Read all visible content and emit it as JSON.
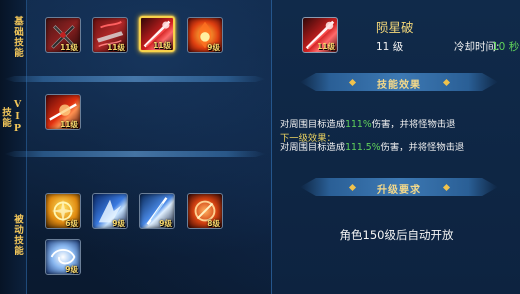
{
  "categories": {
    "base": "基础技能",
    "vip": "VIP技能",
    "passive": "被动技能"
  },
  "base_skills": [
    {
      "icon": "twin-blade-skill-icon",
      "level": "11级"
    },
    {
      "icon": "charging-blade-skill-icon",
      "level": "11级"
    },
    {
      "icon": "meteor-slash-skill-icon",
      "level": "11级",
      "selected": true
    },
    {
      "icon": "flame-burst-skill-icon",
      "level": "9级"
    }
  ],
  "vip_skills": [
    {
      "icon": "fire-strike-skill-icon",
      "level": "11级"
    }
  ],
  "passive_skills": [
    {
      "icon": "golden-aura-skill-icon",
      "level": "6级"
    },
    {
      "icon": "ice-shard-skill-icon",
      "level": "9级"
    },
    {
      "icon": "frost-blade-skill-icon",
      "level": "9级"
    },
    {
      "icon": "fire-orb-skill-icon",
      "level": "8级"
    },
    {
      "icon": "water-swirl-skill-icon",
      "level": "9级"
    }
  ],
  "detail": {
    "icon": "meteor-slash-skill-icon",
    "icon_level": "11级",
    "name": "陨星破",
    "level": "11 级",
    "cooldown_label": "冷却时间:",
    "cooldown_value": "10 秒",
    "effect_header": "技能效果",
    "effect_pre": "对周围目标造成",
    "effect_pct": "111%",
    "effect_post": "伤害，并将怪物击退",
    "next_title": "下一级效果：",
    "next_pre": "对周围目标造成",
    "next_pct": "111.5%",
    "next_post": "伤害，并将怪物击退",
    "upgrade_header": "升级要求",
    "upgrade_text": "角色150级后自动开放"
  },
  "colors": {
    "gold": "#f3d779",
    "green": "#5fd35a",
    "selected_border": "#f7d24a"
  }
}
